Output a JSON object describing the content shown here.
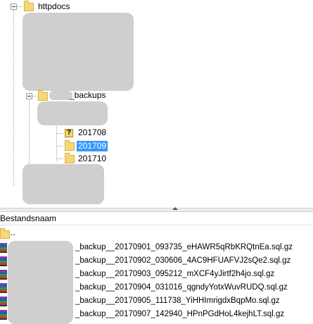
{
  "tree": {
    "root": {
      "label": "httpdocs",
      "icon": "folder-icon"
    },
    "backups_folder": {
      "label": "_backups",
      "icon": "folder-icon"
    },
    "children": [
      {
        "label": "201708",
        "icon": "unknown-folder-icon"
      },
      {
        "label": "201709",
        "icon": "folder-icon",
        "selected": true
      },
      {
        "label": "201710",
        "icon": "folder-icon"
      }
    ]
  },
  "file_list": {
    "column_header": "Bestandsnaam",
    "parent_dir_label": "..",
    "files": [
      {
        "name": "_backup__20170901_093735_eHAWR5qRbKRQtnEa.sql.gz",
        "icon": "archive-icon"
      },
      {
        "name": "_backup__20170902_030606_4AC9HFUAFVJ2sQe2.sql.gz",
        "icon": "archive-icon"
      },
      {
        "name": "_backup__20170903_095212_mXCF4yJirtf2h4jo.sql.gz",
        "icon": "archive-icon"
      },
      {
        "name": "_backup__20170904_031016_qgndyYotxWuvRUDQ.sql.gz",
        "icon": "archive-icon"
      },
      {
        "name": "_backup__20170905_111738_YiHHImrigdxBqpMo.sql.gz",
        "icon": "archive-icon"
      },
      {
        "name": "_backup__20170907_142940_HPnPGdHoL4kejhLT.sql.gz",
        "icon": "archive-icon"
      }
    ]
  },
  "colors": {
    "selection": "#3399ff",
    "redaction": "#cfcfcf"
  }
}
